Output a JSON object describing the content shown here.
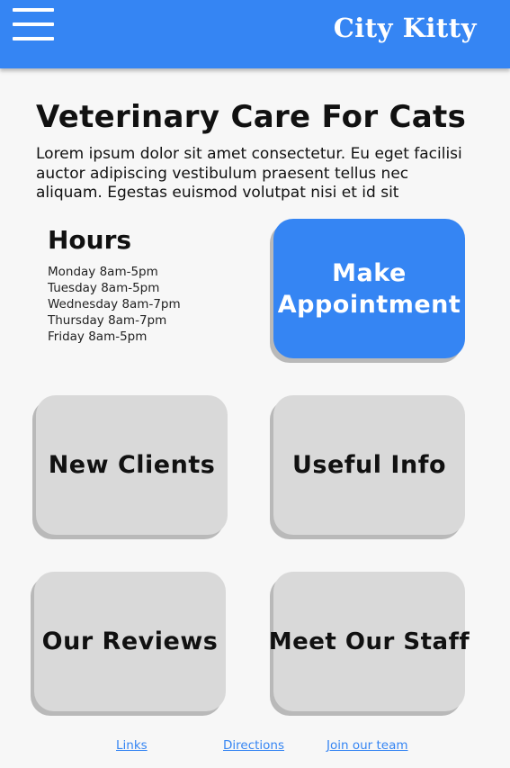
{
  "header": {
    "brand": "City Kitty",
    "menu_icon": "hamburger-menu-icon",
    "color": "#3585f3"
  },
  "main": {
    "title": "Veterinary Care For Cats",
    "intro": "Lorem ipsum dolor sit amet consectetur. Eu eget facilisi auctor adipiscing vestibulum praesent tellus nec aliquam. Egestas euismod volutpat nisi et id sit"
  },
  "hours": {
    "title": "Hours",
    "items": [
      "Monday 8am-5pm",
      "Tuesday 8am-5pm",
      "Wednesday 8am-7pm",
      "Thursday 8am-7pm",
      "Friday 8am-5pm"
    ]
  },
  "tiles": {
    "appointment": "Make Appointment",
    "new_clients": "New Clients",
    "useful_info": "Useful Info",
    "reviews": "Our Reviews",
    "staff": "Meet Our Staff"
  },
  "footer": {
    "links": "Links",
    "directions": "Directions",
    "join": "Join our team"
  },
  "colors": {
    "accent": "#3585f3",
    "tile_grey": "#d9d9d9",
    "background": "#f7f7f7"
  }
}
